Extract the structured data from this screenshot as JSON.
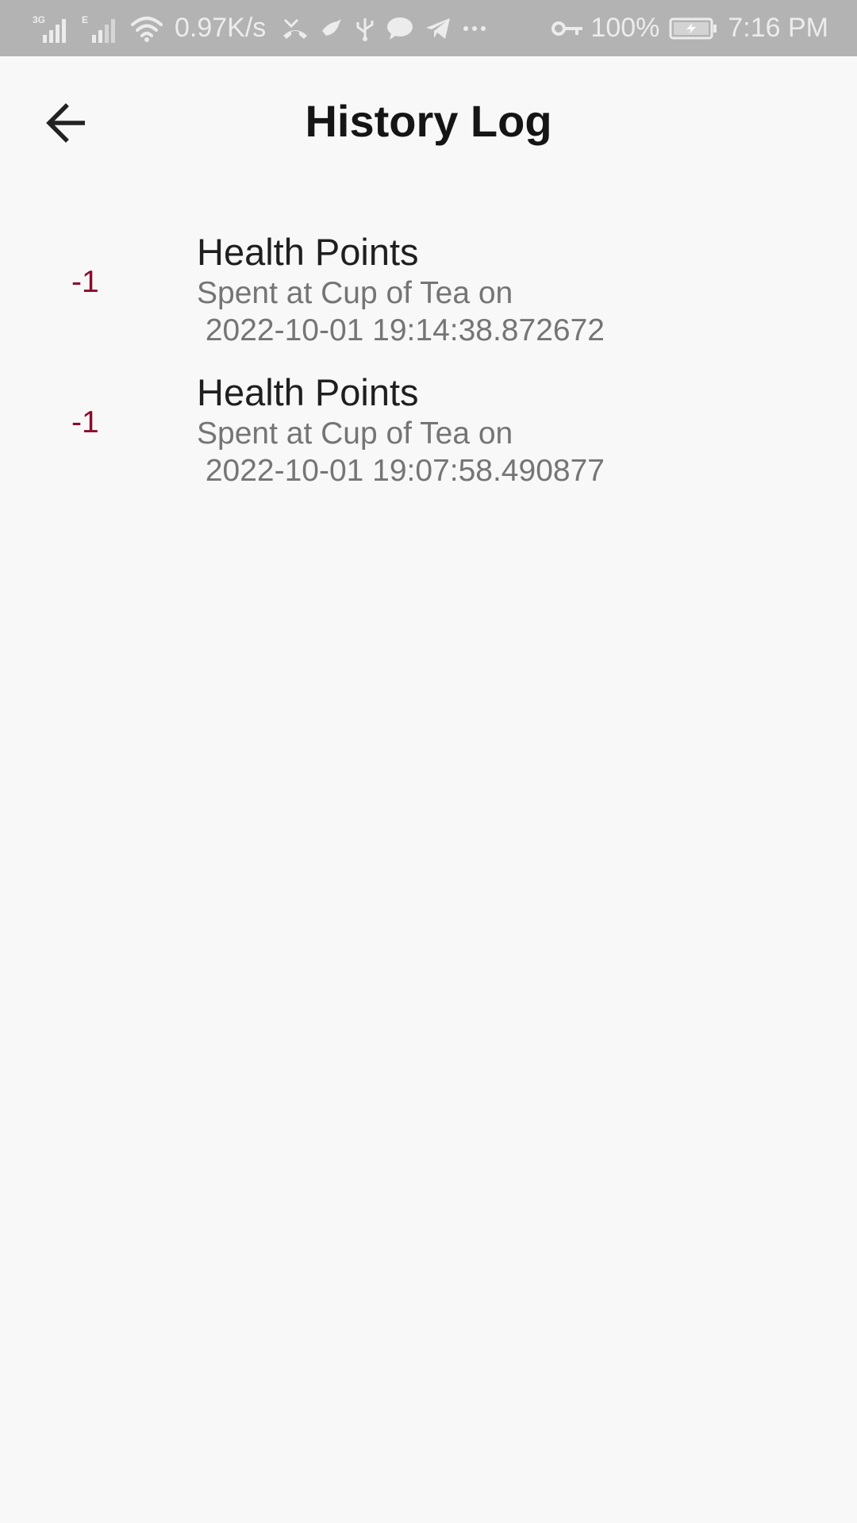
{
  "status_bar": {
    "network_3g": "3G",
    "network_e": "E",
    "speed": "0.97K/s",
    "battery_percent": "100%",
    "time": "7:16 PM",
    "icons": [
      "signal-3g-icon",
      "signal-e-icon",
      "wifi-icon",
      "missed-call-icon",
      "bird-app-icon",
      "usb-icon",
      "chat-bubble-icon",
      "telegram-icon",
      "more-dots-icon",
      "vpn-key-icon",
      "battery-charging-icon"
    ]
  },
  "app_bar": {
    "title": "History Log",
    "back_icon": "arrow-back-icon"
  },
  "history": {
    "items": [
      {
        "amount": "-1",
        "title": "Health Points",
        "line1": "Spent at Cup of Tea on",
        "line2": " 2022-10-01 19:14:38.872672"
      },
      {
        "amount": "-1",
        "title": "Health Points",
        "line1": "Spent at Cup of Tea on",
        "line2": " 2022-10-01 19:07:58.490877"
      }
    ]
  },
  "colors": {
    "status_bar_bg": "#b3b3b3",
    "page_bg": "#f8f8f8",
    "amount": "#8c0a2b",
    "title": "#1f1f1f",
    "subtitle": "#757575"
  }
}
